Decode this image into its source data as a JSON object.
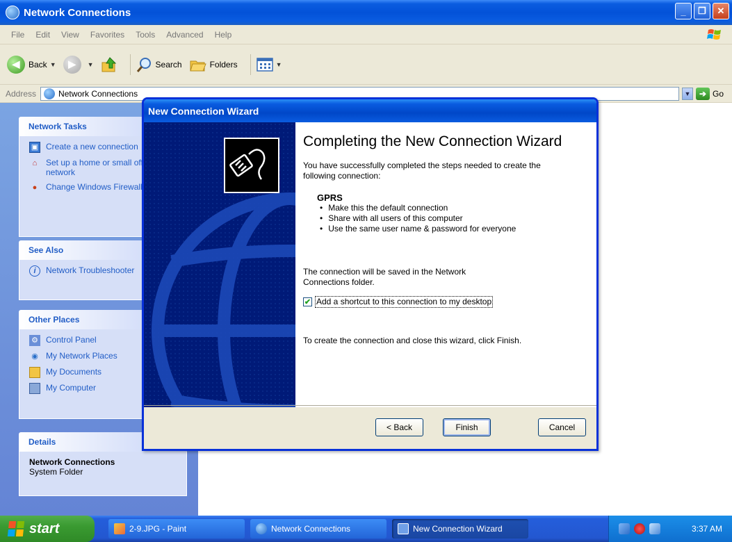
{
  "window": {
    "title": "Network Connections"
  },
  "menu": [
    "File",
    "Edit",
    "View",
    "Favorites",
    "Tools",
    "Advanced",
    "Help"
  ],
  "toolbar": {
    "back": "Back",
    "search": "Search",
    "folders": "Folders"
  },
  "address": {
    "label": "Address",
    "value": "Network Connections",
    "go": "Go"
  },
  "panels": {
    "network_tasks": {
      "title": "Network Tasks",
      "items": [
        "Create a new connection",
        "Set up a home or small office network",
        "Change Windows Firewall settings"
      ]
    },
    "see_also": {
      "title": "See Also",
      "items": [
        "Network Troubleshooter"
      ]
    },
    "other_places": {
      "title": "Other Places",
      "items": [
        "Control Panel",
        "My Network Places",
        "My Documents",
        "My Computer"
      ]
    },
    "details": {
      "title": "Details",
      "name": "Network Connections",
      "sub": "System Folder"
    }
  },
  "wizard": {
    "title": "New Connection Wizard",
    "heading": "Completing the New Connection Wizard",
    "intro": "You have successfully completed the steps needed to create the following connection:",
    "connection_name": "GPRS",
    "bullets": [
      "Make this the default connection",
      "Share with all users of this computer",
      "Use the same user name & password for everyone"
    ],
    "saved_text": "The connection will be saved in the Network Connections folder.",
    "shortcut_label": "Add a shortcut to this connection to my desktop",
    "shortcut_checked": true,
    "finish_text": "To create the connection and close this wizard, click Finish.",
    "buttons": {
      "back": "< Back",
      "finish": "Finish",
      "cancel": "Cancel"
    }
  },
  "taskbar": {
    "start": "start",
    "items": [
      "2-9.JPG - Paint",
      "Network Connections",
      "New Connection Wizard"
    ],
    "clock": "3:37 AM"
  }
}
